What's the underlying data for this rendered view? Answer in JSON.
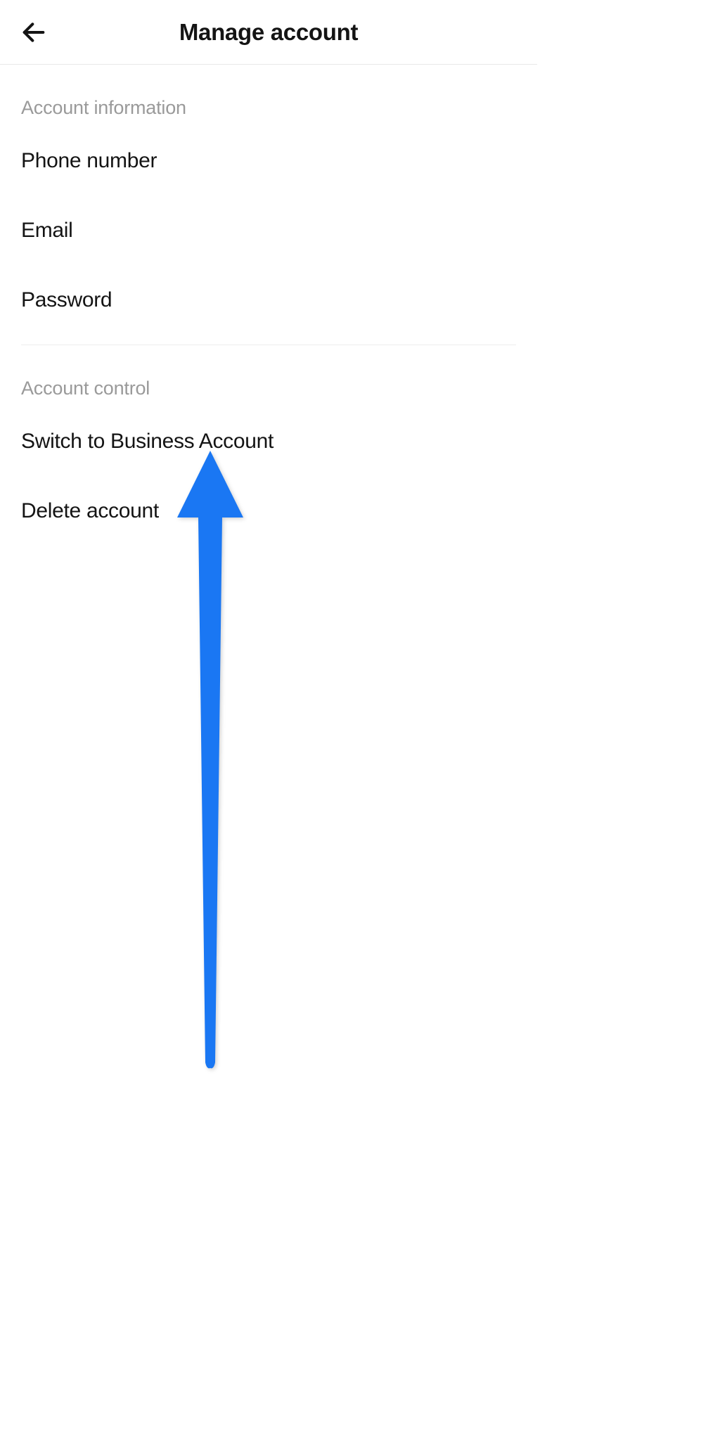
{
  "header": {
    "title": "Manage account"
  },
  "sections": {
    "info": {
      "label": "Account information",
      "items": {
        "phone": "Phone number",
        "email": "Email",
        "password": "Password"
      }
    },
    "control": {
      "label": "Account control",
      "items": {
        "switch": "Switch to Business Account",
        "delete": "Delete account"
      }
    }
  },
  "colors": {
    "arrow": "#1A77F3"
  }
}
